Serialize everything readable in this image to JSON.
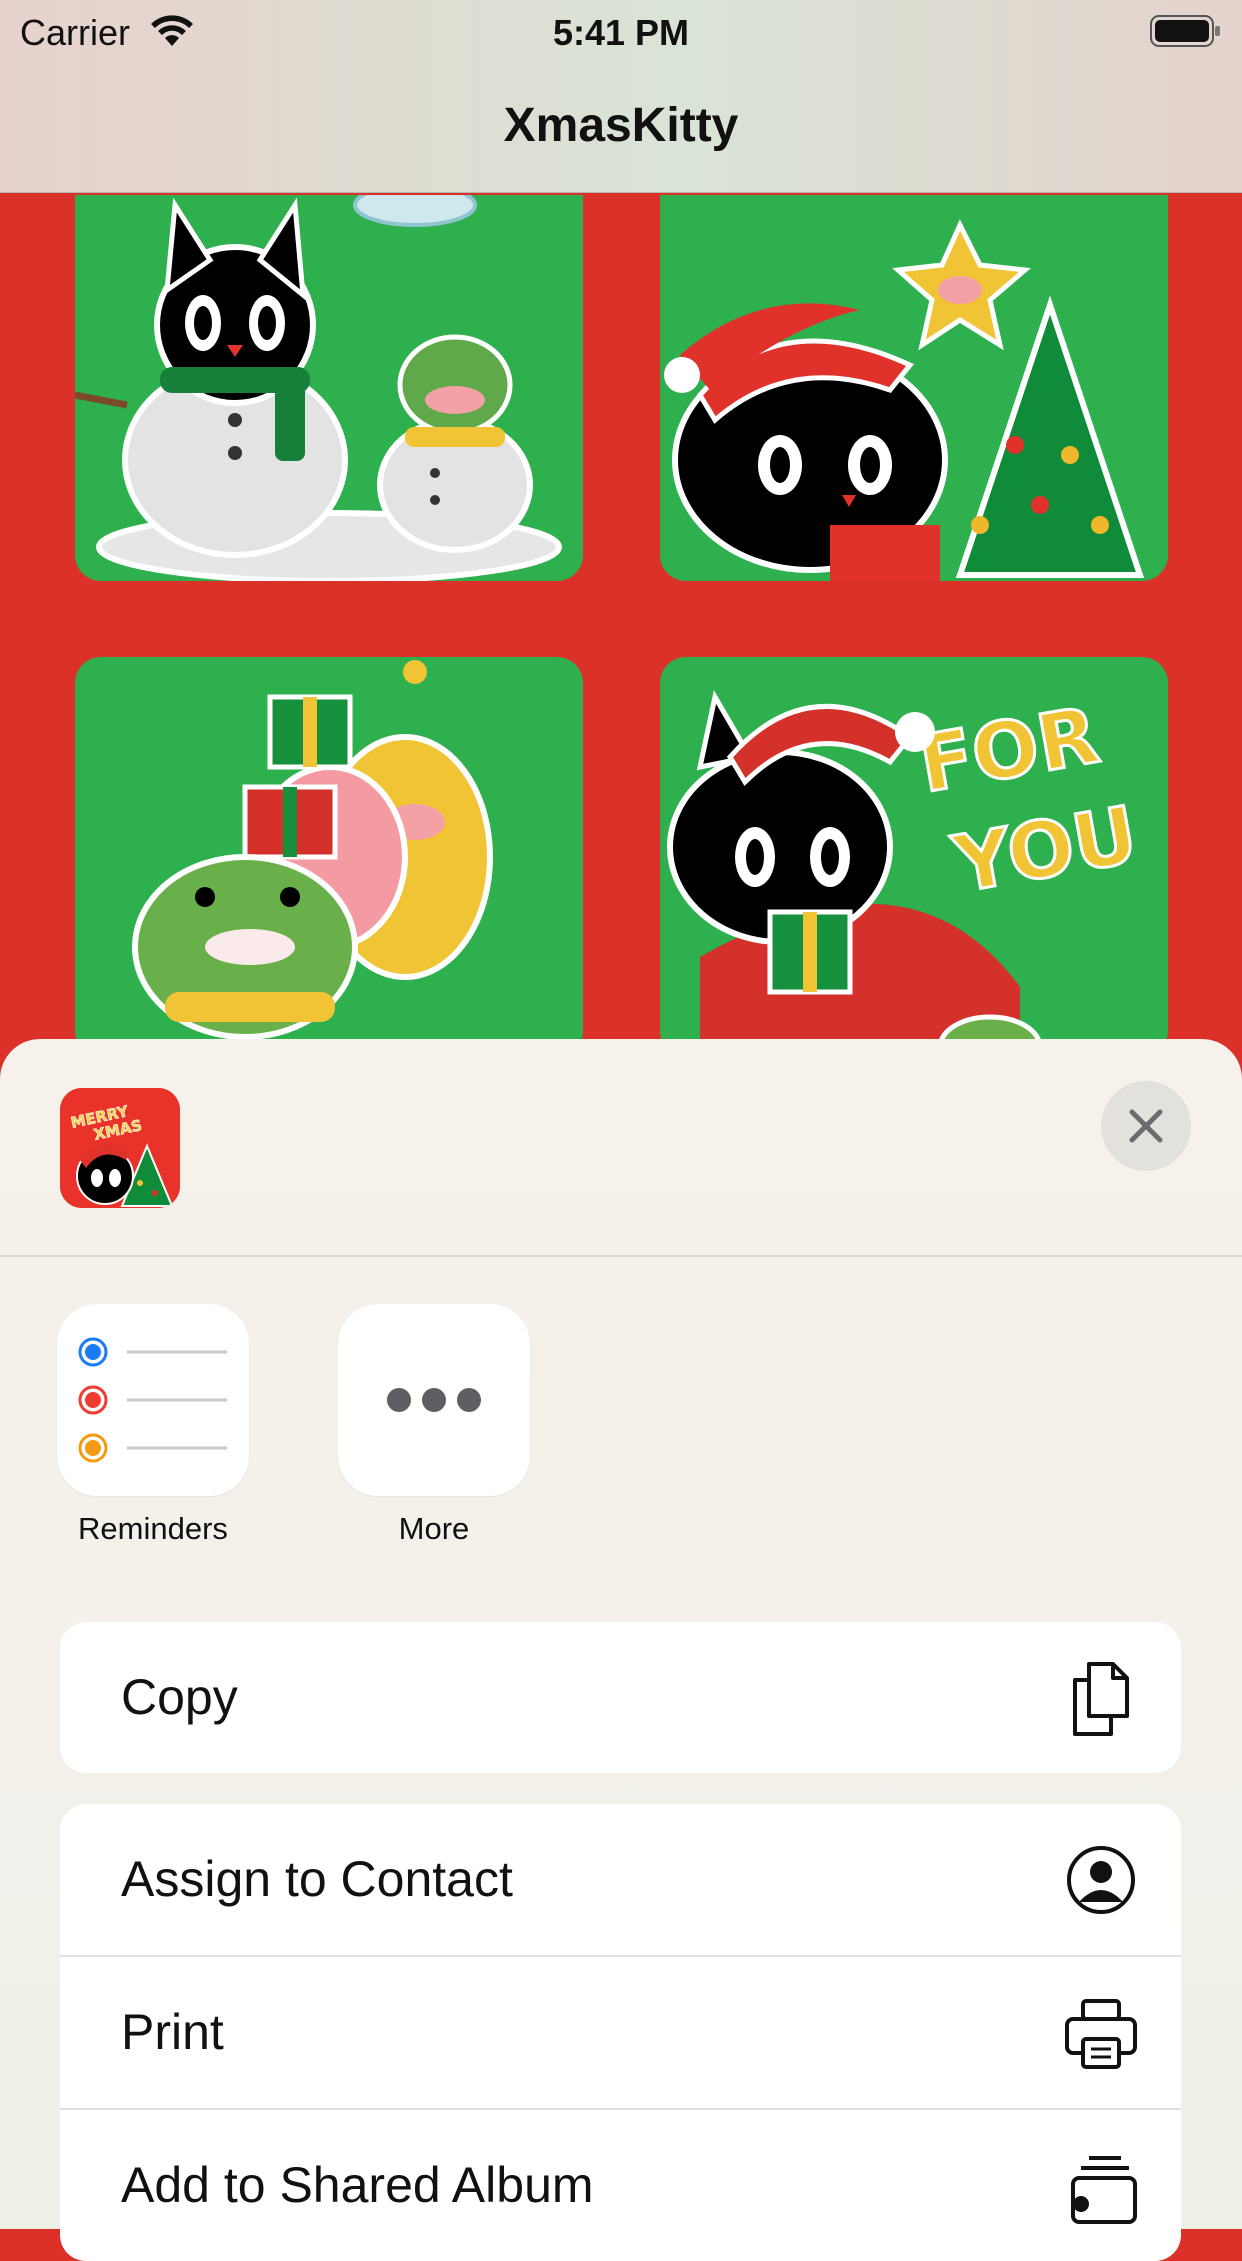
{
  "status_bar": {
    "carrier": "Carrier",
    "time": "5:41 PM",
    "wifi_icon": "wifi-icon",
    "battery_icon": "battery-full-icon"
  },
  "nav": {
    "title": "XmasKitty"
  },
  "stickers": [
    {
      "name": "snowman-kitty-sticker"
    },
    {
      "name": "kitty-christmas-tree-sticker"
    },
    {
      "name": "monsters-with-gifts-sticker"
    },
    {
      "name": "for-you-kitty-sticker",
      "text": "FOR YOU"
    }
  ],
  "share_sheet": {
    "preview_icon": "xmas-kitty-app-icon",
    "preview_text": "MERRY XMAS",
    "close_icon": "close-icon",
    "apps": [
      {
        "label": "Reminders",
        "icon": "reminders-icon"
      },
      {
        "label": "More",
        "icon": "more-ellipsis-icon"
      }
    ],
    "actions_group1": [
      {
        "label": "Copy",
        "icon": "copy-icon"
      }
    ],
    "actions_group2": [
      {
        "label": "Assign to Contact",
        "icon": "contact-icon"
      },
      {
        "label": "Print",
        "icon": "printer-icon"
      },
      {
        "label": "Add to Shared Album",
        "icon": "shared-album-icon"
      }
    ]
  },
  "colors": {
    "background_red": "#dc3129",
    "tile_green": "#2db04d",
    "sheet_bg": "#f5f1ea"
  }
}
